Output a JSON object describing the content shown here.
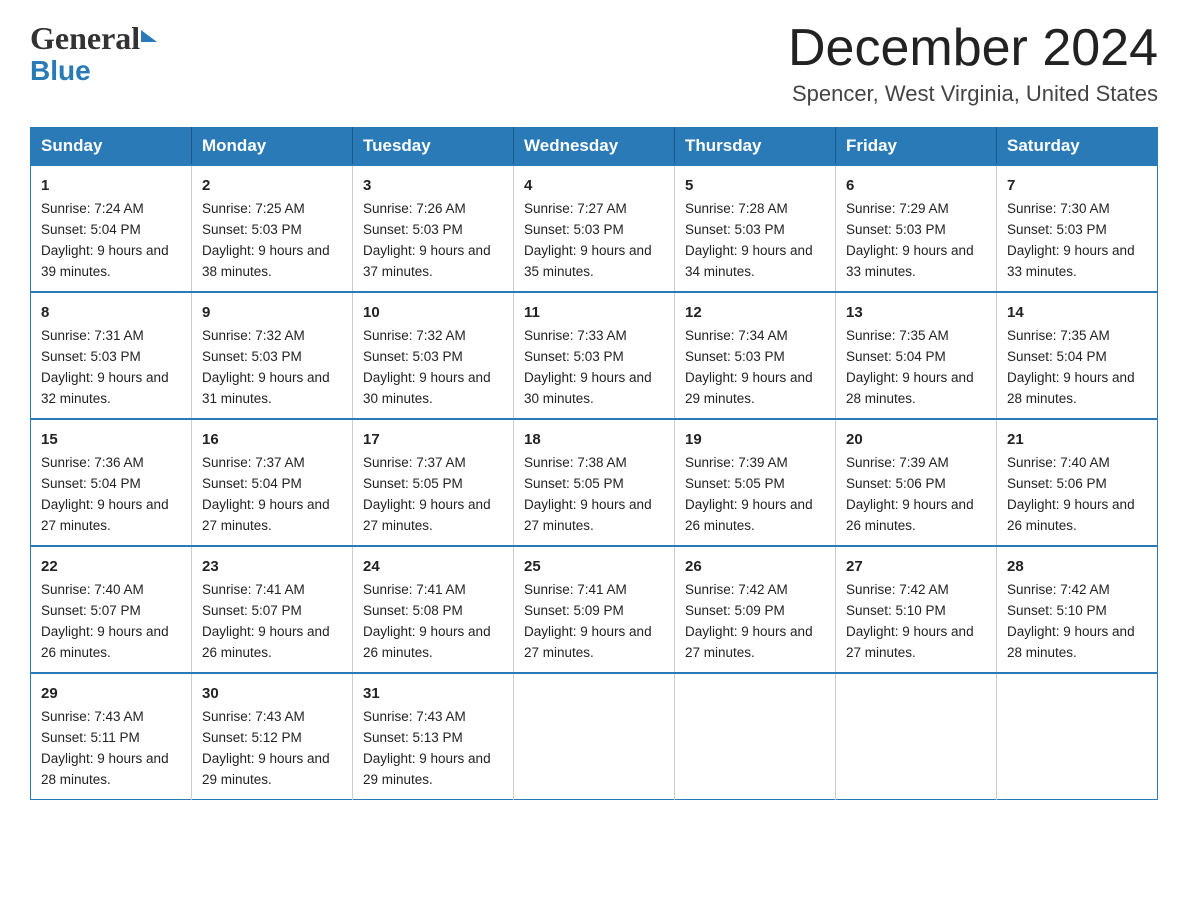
{
  "header": {
    "logo_line1": "General",
    "logo_line2": "Blue",
    "month_title": "December 2024",
    "location": "Spencer, West Virginia, United States"
  },
  "weekdays": [
    "Sunday",
    "Monday",
    "Tuesday",
    "Wednesday",
    "Thursday",
    "Friday",
    "Saturday"
  ],
  "weeks": [
    [
      {
        "day": "1",
        "sunrise": "7:24 AM",
        "sunset": "5:04 PM",
        "daylight": "9 hours and 39 minutes."
      },
      {
        "day": "2",
        "sunrise": "7:25 AM",
        "sunset": "5:03 PM",
        "daylight": "9 hours and 38 minutes."
      },
      {
        "day": "3",
        "sunrise": "7:26 AM",
        "sunset": "5:03 PM",
        "daylight": "9 hours and 37 minutes."
      },
      {
        "day": "4",
        "sunrise": "7:27 AM",
        "sunset": "5:03 PM",
        "daylight": "9 hours and 35 minutes."
      },
      {
        "day": "5",
        "sunrise": "7:28 AM",
        "sunset": "5:03 PM",
        "daylight": "9 hours and 34 minutes."
      },
      {
        "day": "6",
        "sunrise": "7:29 AM",
        "sunset": "5:03 PM",
        "daylight": "9 hours and 33 minutes."
      },
      {
        "day": "7",
        "sunrise": "7:30 AM",
        "sunset": "5:03 PM",
        "daylight": "9 hours and 33 minutes."
      }
    ],
    [
      {
        "day": "8",
        "sunrise": "7:31 AM",
        "sunset": "5:03 PM",
        "daylight": "9 hours and 32 minutes."
      },
      {
        "day": "9",
        "sunrise": "7:32 AM",
        "sunset": "5:03 PM",
        "daylight": "9 hours and 31 minutes."
      },
      {
        "day": "10",
        "sunrise": "7:32 AM",
        "sunset": "5:03 PM",
        "daylight": "9 hours and 30 minutes."
      },
      {
        "day": "11",
        "sunrise": "7:33 AM",
        "sunset": "5:03 PM",
        "daylight": "9 hours and 30 minutes."
      },
      {
        "day": "12",
        "sunrise": "7:34 AM",
        "sunset": "5:03 PM",
        "daylight": "9 hours and 29 minutes."
      },
      {
        "day": "13",
        "sunrise": "7:35 AM",
        "sunset": "5:04 PM",
        "daylight": "9 hours and 28 minutes."
      },
      {
        "day": "14",
        "sunrise": "7:35 AM",
        "sunset": "5:04 PM",
        "daylight": "9 hours and 28 minutes."
      }
    ],
    [
      {
        "day": "15",
        "sunrise": "7:36 AM",
        "sunset": "5:04 PM",
        "daylight": "9 hours and 27 minutes."
      },
      {
        "day": "16",
        "sunrise": "7:37 AM",
        "sunset": "5:04 PM",
        "daylight": "9 hours and 27 minutes."
      },
      {
        "day": "17",
        "sunrise": "7:37 AM",
        "sunset": "5:05 PM",
        "daylight": "9 hours and 27 minutes."
      },
      {
        "day": "18",
        "sunrise": "7:38 AM",
        "sunset": "5:05 PM",
        "daylight": "9 hours and 27 minutes."
      },
      {
        "day": "19",
        "sunrise": "7:39 AM",
        "sunset": "5:05 PM",
        "daylight": "9 hours and 26 minutes."
      },
      {
        "day": "20",
        "sunrise": "7:39 AM",
        "sunset": "5:06 PM",
        "daylight": "9 hours and 26 minutes."
      },
      {
        "day": "21",
        "sunrise": "7:40 AM",
        "sunset": "5:06 PM",
        "daylight": "9 hours and 26 minutes."
      }
    ],
    [
      {
        "day": "22",
        "sunrise": "7:40 AM",
        "sunset": "5:07 PM",
        "daylight": "9 hours and 26 minutes."
      },
      {
        "day": "23",
        "sunrise": "7:41 AM",
        "sunset": "5:07 PM",
        "daylight": "9 hours and 26 minutes."
      },
      {
        "day": "24",
        "sunrise": "7:41 AM",
        "sunset": "5:08 PM",
        "daylight": "9 hours and 26 minutes."
      },
      {
        "day": "25",
        "sunrise": "7:41 AM",
        "sunset": "5:09 PM",
        "daylight": "9 hours and 27 minutes."
      },
      {
        "day": "26",
        "sunrise": "7:42 AM",
        "sunset": "5:09 PM",
        "daylight": "9 hours and 27 minutes."
      },
      {
        "day": "27",
        "sunrise": "7:42 AM",
        "sunset": "5:10 PM",
        "daylight": "9 hours and 27 minutes."
      },
      {
        "day": "28",
        "sunrise": "7:42 AM",
        "sunset": "5:10 PM",
        "daylight": "9 hours and 28 minutes."
      }
    ],
    [
      {
        "day": "29",
        "sunrise": "7:43 AM",
        "sunset": "5:11 PM",
        "daylight": "9 hours and 28 minutes."
      },
      {
        "day": "30",
        "sunrise": "7:43 AM",
        "sunset": "5:12 PM",
        "daylight": "9 hours and 29 minutes."
      },
      {
        "day": "31",
        "sunrise": "7:43 AM",
        "sunset": "5:13 PM",
        "daylight": "9 hours and 29 minutes."
      },
      null,
      null,
      null,
      null
    ]
  ]
}
